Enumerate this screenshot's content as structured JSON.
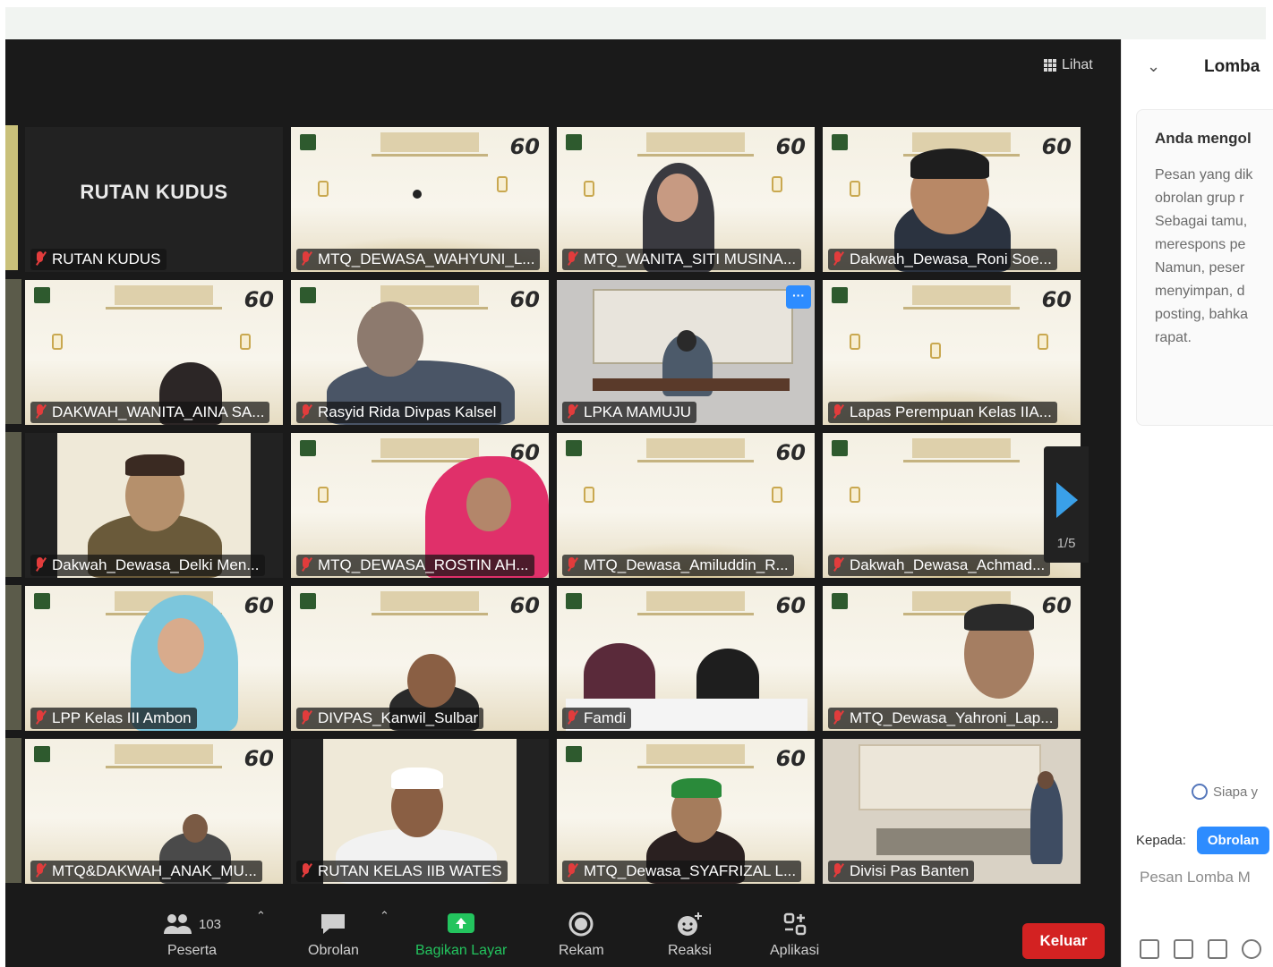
{
  "meeting": {
    "view_label": "Lihat",
    "tiles": [
      {
        "name": "RUTAN KUDUS",
        "big_label": "RUTAN KUDUS"
      },
      {
        "name": "MTQ_DEWASA_WAHYUNI_L..."
      },
      {
        "name": "MTQ_WANITA_SITI MUSINA..."
      },
      {
        "name": "Dakwah_Dewasa_Roni Soe..."
      },
      {
        "name": "DAKWAH_WANITA_AINA SA..."
      },
      {
        "name": "Rasyid Rida Divpas Kalsel"
      },
      {
        "name": "LPKA MAMUJU"
      },
      {
        "name": "Lapas Perempuan Kelas IIA..."
      },
      {
        "name": "Dakwah_Dewasa_Delki Men..."
      },
      {
        "name": "MTQ_DEWASA_ROSTIN AH..."
      },
      {
        "name": "MTQ_Dewasa_Amiluddin_R..."
      },
      {
        "name": "Dakwah_Dewasa_Achmad..."
      },
      {
        "name": "LPP Kelas III Ambon"
      },
      {
        "name": "DIVPAS_Kanwil_Sulbar"
      },
      {
        "name": "Famdi"
      },
      {
        "name": "MTQ_Dewasa_Yahroni_Lap..."
      },
      {
        "name": "MTQ&DAKWAH_ANAK_MU..."
      },
      {
        "name": "RUTAN KELAS IIB WATES"
      },
      {
        "name": "MTQ_Dewasa_SYAFRIZAL L..."
      },
      {
        "name": "Divisi Pas Banten"
      }
    ],
    "banner_badge": "60",
    "page_indicator": "1/5",
    "more_dots": "···"
  },
  "toolbar": {
    "participants_label": "Peserta",
    "participants_count": "103",
    "chat_label": "Obrolan",
    "share_label": "Bagikan Layar",
    "record_label": "Rekam",
    "reactions_label": "Reaksi",
    "apps_label": "Aplikasi",
    "leave_label": "Keluar"
  },
  "chat_panel": {
    "title": "Lomba",
    "notice_title": "Anda mengol",
    "notice_body": "Pesan yang dik\nobrolan grup r\nSebagai tamu,\nmerespons pe\nNamun, peser\nmenyimpan, d\nposting, bahka\nrapat.",
    "who_can_see": "Siapa y",
    "to_label": "Kepada:",
    "to_button": "Obrolan",
    "input_placeholder": "Pesan Lomba M"
  },
  "colors": {
    "accent_blue": "#2d8cff",
    "share_green": "#23c45e",
    "leave_red": "#d32222",
    "meeting_bg": "#1a1a1a"
  }
}
